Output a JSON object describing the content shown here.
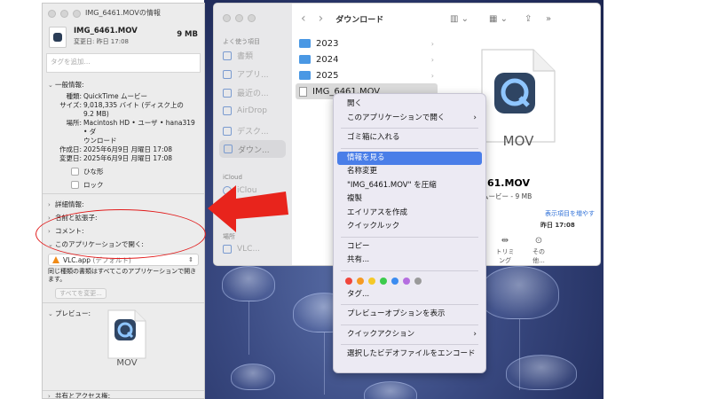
{
  "info_window": {
    "title": "IMG_6461.MOVの情報",
    "file_name": "IMG_6461.MOV",
    "file_size": "9 MB",
    "modified_short": "変更日: 昨日 17:08",
    "tag_placeholder": "タグを追加...",
    "general": {
      "header": "一般情報:",
      "rows": [
        {
          "k": "種類:",
          "v": "QuickTime ムービー"
        },
        {
          "k": "サイズ:",
          "v": "9,018,335 バイト (ディスク上の"
        },
        {
          "k": "",
          "v": "9.2 MB)"
        },
        {
          "k": "場所:",
          "v": "Macintosh HD • ユーザ • hana319 • ダ"
        },
        {
          "k": "",
          "v": "ウンロード"
        },
        {
          "k": "作成日:",
          "v": "2025年6月9日 月曜日 17:08"
        },
        {
          "k": "変更日:",
          "v": "2025年6月9日 月曜日 17:08"
        }
      ],
      "stationery": "ひな形",
      "locked": "ロック"
    },
    "more_info": "詳細情報:",
    "name_ext": "名前と拡張子:",
    "comments": "コメント:",
    "open_with": {
      "label": "このアプリケーションで開く:",
      "app": "VLC.app",
      "app_suffix": "(デフォルト)",
      "note": "同じ種類の書類はすべてこのアプリケーションで開きます。",
      "change_all": "すべてを変更..."
    },
    "preview_label": "プレビュー:",
    "preview_ext": "MOV",
    "sharing": "共有とアクセス権:"
  },
  "finder": {
    "title": "ダウンロード",
    "sidebar": {
      "favorites_header": "よく使う項目",
      "items": [
        "書類",
        "アプリ...",
        "最近の...",
        "AirDrop",
        "デスク...",
        "ダウン..."
      ],
      "icloud_header": "iCloud",
      "icloud_item": "iClou",
      "locations_header": "場所",
      "locations_item": "VLC..."
    },
    "list": [
      "2023",
      "2024",
      "2025"
    ],
    "selected_file": "IMG_6461.MOV",
    "preview": {
      "ext": "MOV",
      "name": "61.MOV",
      "kind": "ムービー - 9 MB",
      "more": "表示項目を増やす",
      "date_snippet": "昨日 17:08",
      "actions": [
        {
          "glyph": "⇹",
          "label": "トリミング"
        },
        {
          "glyph": "⊙",
          "label": "その他..."
        }
      ]
    }
  },
  "context_menu": {
    "items_top": [
      "開く",
      "このアプリケーションで開く"
    ],
    "trash": "ゴミ箱に入れる",
    "items_mid": [
      "情報を見る",
      "名称変更",
      "\"IMG_6461.MOV\" を圧縮",
      "複製",
      "エイリアスを作成",
      "クイックルック"
    ],
    "items_copy": [
      "コピー",
      "共有..."
    ],
    "tag_colors": [
      "#f0463c",
      "#f59a23",
      "#f5c928",
      "#3ccb4c",
      "#3c8cf0",
      "#b56ee0",
      "#9a9a9a"
    ],
    "tags": "タグ...",
    "preview_options": "プレビューオプションを表示",
    "quick_actions": "クイックアクション",
    "encode": "選択したビデオファイルをエンコード",
    "highlight_color": "#4a7ee8"
  },
  "annotation": {
    "arrow_color": "#e8241c"
  }
}
